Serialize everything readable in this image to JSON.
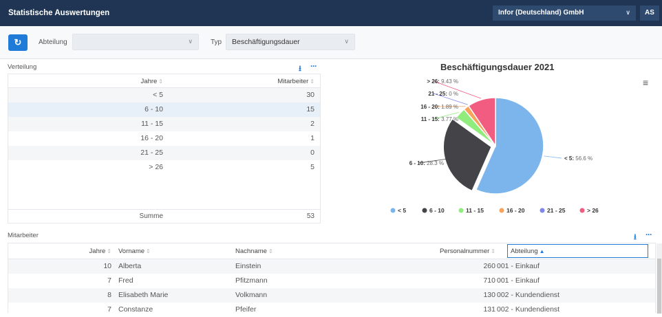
{
  "header": {
    "title": "Statistische Auswertungen",
    "company": "Infor (Deutschland) GmbH",
    "user_initials": "AS"
  },
  "filters": {
    "department_label": "Abteilung",
    "department_value": "",
    "type_label": "Typ",
    "type_value": "Beschäftigungsdauer"
  },
  "distribution": {
    "title": "Verteilung",
    "columns": [
      "Jahre",
      "Mitarbeiter"
    ],
    "rows": [
      {
        "jahre": "< 5",
        "mitarbeiter": "30"
      },
      {
        "jahre": "6 - 10",
        "mitarbeiter": "15"
      },
      {
        "jahre": "11 - 15",
        "mitarbeiter": "2"
      },
      {
        "jahre": "16 - 20",
        "mitarbeiter": "1"
      },
      {
        "jahre": "21 - 25",
        "mitarbeiter": "0"
      },
      {
        "jahre": "> 26",
        "mitarbeiter": "5"
      }
    ],
    "sum_label": "Summe",
    "sum_value": "53"
  },
  "chart_data": {
    "type": "pie",
    "title": "Beschäftigungsdauer 2021",
    "slices": [
      {
        "label": "< 5",
        "value": 56.6,
        "color": "#7cb5ec",
        "display": "< 5: 56.6 %"
      },
      {
        "label": "6 - 10",
        "value": 28.3,
        "color": "#434348",
        "display": "6 - 10: 28.3 %"
      },
      {
        "label": "11 - 15",
        "value": 3.77,
        "color": "#90ed7d",
        "display": "11 - 15: 3.77 %"
      },
      {
        "label": "16 - 20",
        "value": 1.89,
        "color": "#f7a35c",
        "display": "16 - 20: 1.89 %"
      },
      {
        "label": "21 - 25",
        "value": 0,
        "color": "#8085e9",
        "display": "21 - 25: 0 %"
      },
      {
        "label": "> 26",
        "value": 9.43,
        "color": "#f15c80",
        "display": "> 26: 9.43 %"
      }
    ],
    "legend": [
      "< 5",
      "6 - 10",
      "11 - 15",
      "16 - 20",
      "21 - 25",
      "> 26"
    ],
    "legend_position": "bottom"
  },
  "employees": {
    "title": "Mitarbeiter",
    "columns": [
      "Jahre",
      "Vorname",
      "Nachname",
      "Personalnummer",
      "Abteilung"
    ],
    "rows": [
      {
        "jahre": "10",
        "vorname": "Alberta",
        "nachname": "Einstein",
        "personalnummer": "260",
        "abteilung": "001 - Einkauf"
      },
      {
        "jahre": "7",
        "vorname": "Fred",
        "nachname": "Pfitzmann",
        "personalnummer": "710",
        "abteilung": "001 - Einkauf"
      },
      {
        "jahre": "8",
        "vorname": "Elisabeth Marie",
        "nachname": "Volkmann",
        "personalnummer": "130",
        "abteilung": "002 - Kundendienst"
      },
      {
        "jahre": "7",
        "vorname": "Constanze",
        "nachname": "Pfeifer",
        "personalnummer": "131",
        "abteilung": "002 - Kundendienst"
      }
    ]
  }
}
